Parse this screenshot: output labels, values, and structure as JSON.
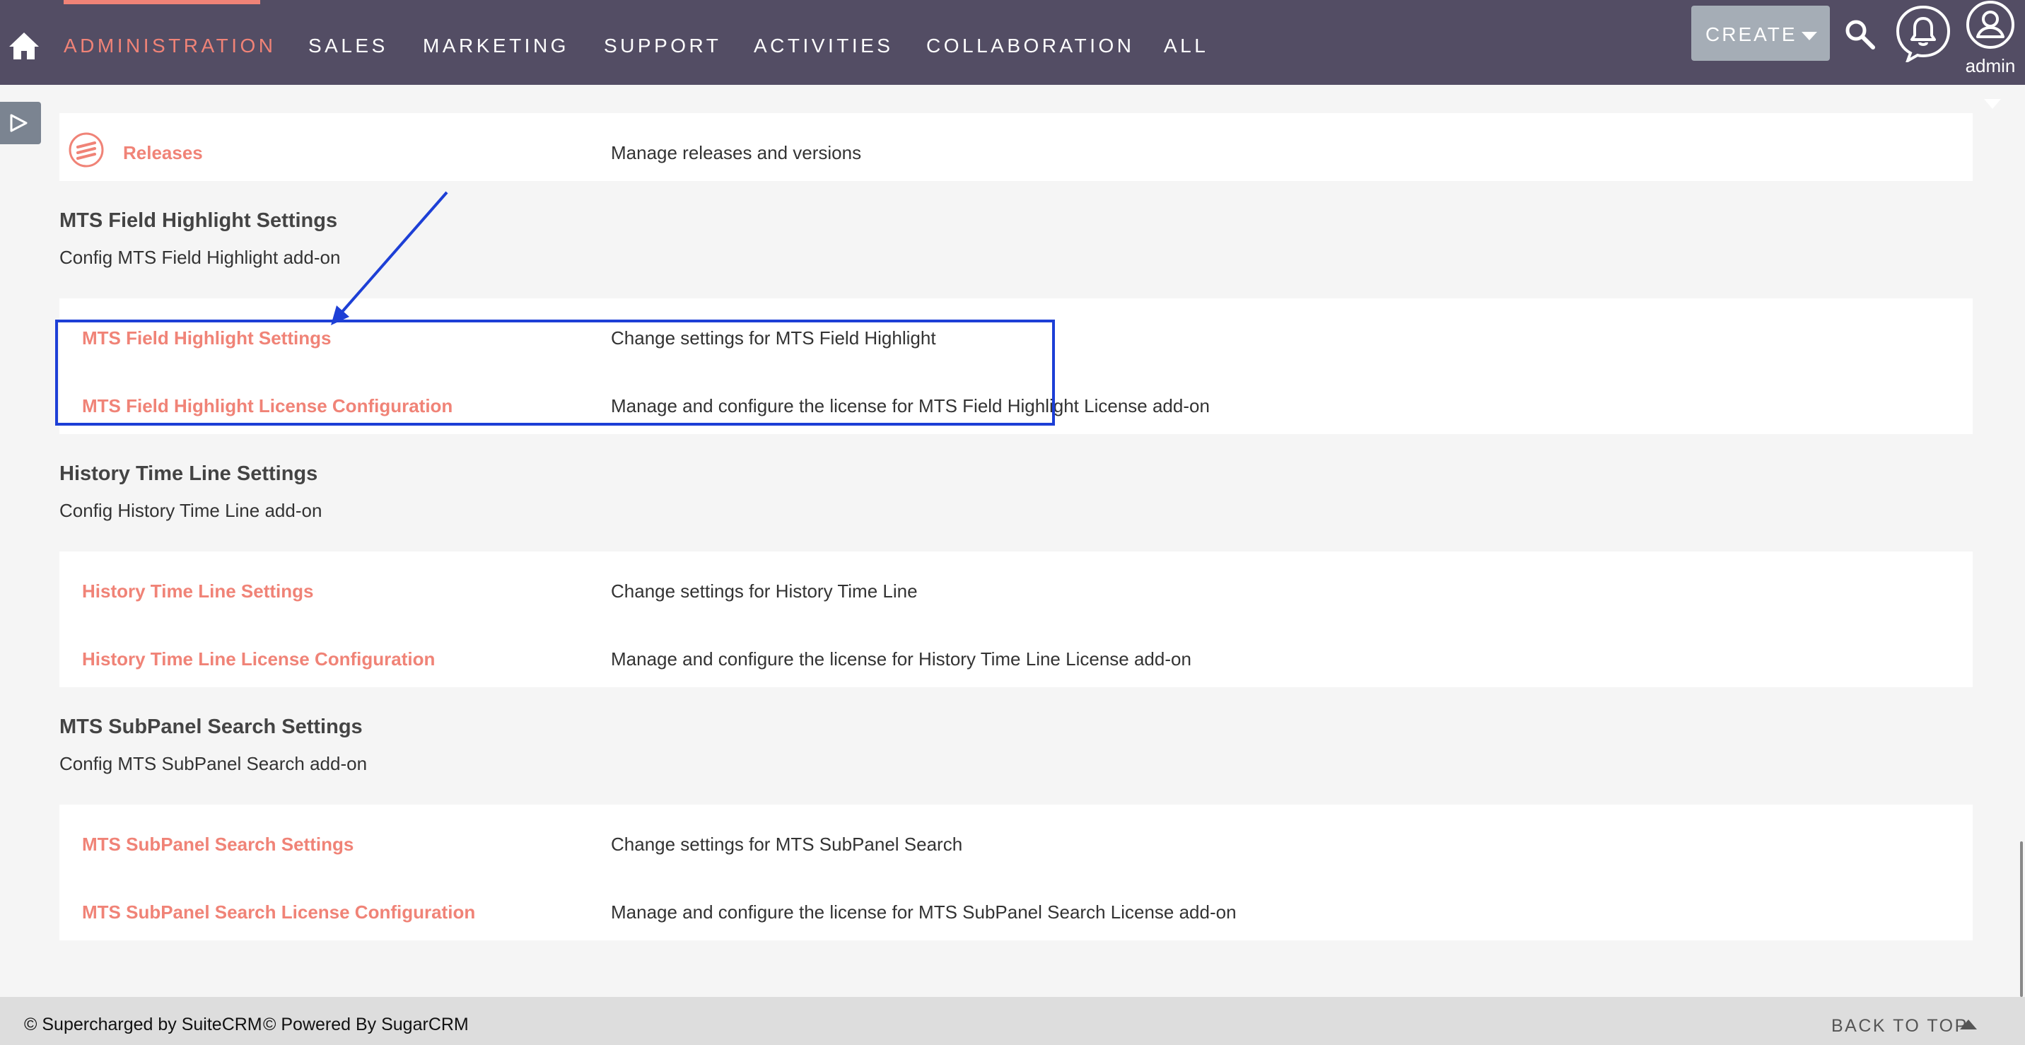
{
  "nav": {
    "items": [
      {
        "label": "ADMINISTRATION",
        "active": true
      },
      {
        "label": "SALES"
      },
      {
        "label": "MARKETING"
      },
      {
        "label": "SUPPORT"
      },
      {
        "label": "ACTIVITIES"
      },
      {
        "label": "COLLABORATION"
      },
      {
        "label": "ALL"
      }
    ],
    "create_label": "CREATE",
    "user_name": "admin"
  },
  "releases": {
    "link": "Releases",
    "description": "Manage releases and versions"
  },
  "sections": [
    {
      "title": "MTS Field Highlight Settings",
      "description": "Config MTS Field Highlight add-on",
      "rows": [
        {
          "link": "MTS Field Highlight Settings",
          "description": "Change settings for MTS Field Highlight"
        },
        {
          "link": "MTS Field Highlight License Configuration",
          "description": "Manage and configure the license for MTS Field Highlight License add-on"
        }
      ]
    },
    {
      "title": "History Time Line Settings",
      "description": "Config History Time Line add-on",
      "rows": [
        {
          "link": "History Time Line Settings",
          "description": "Change settings for History Time Line"
        },
        {
          "link": "History Time Line License Configuration",
          "description": "Manage and configure the license for History Time Line License add-on"
        }
      ]
    },
    {
      "title": "MTS SubPanel Search Settings",
      "description": "Config MTS SubPanel Search add-on",
      "rows": [
        {
          "link": "MTS SubPanel Search Settings",
          "description": "Change settings for MTS SubPanel Search"
        },
        {
          "link": "MTS SubPanel Search License Configuration",
          "description": "Manage and configure the license for MTS SubPanel Search License add-on"
        }
      ]
    }
  ],
  "footer": {
    "suitecrm": "© Supercharged by SuiteCRM",
    "sugarcrm": "© Powered By SugarCRM",
    "back_to_top": "BACK TO TOP"
  },
  "colors": {
    "nav_bg": "#534d64",
    "accent": "#f08377",
    "create_bg": "#a5adb6",
    "annotation": "#1d3fd6",
    "footer_bg": "#dddddd"
  },
  "icons": [
    "home-icon",
    "search-icon",
    "bell-icon",
    "user-icon",
    "releases-icon",
    "play-icon",
    "caret-up-icon"
  ]
}
